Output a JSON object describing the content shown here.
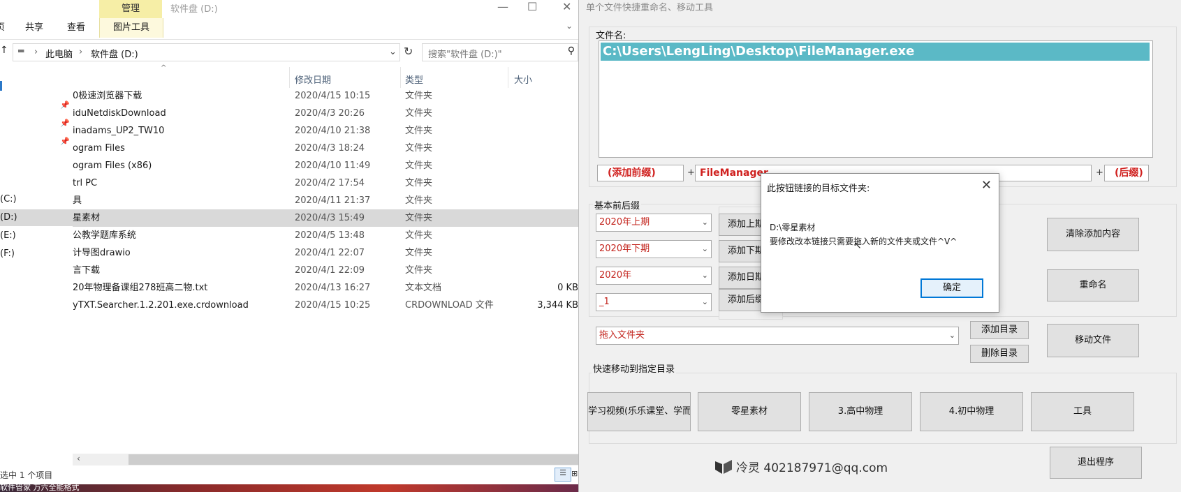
{
  "explorer": {
    "ribbon_tabs": [
      "页",
      "共享",
      "查看"
    ],
    "manage_tab": "管理",
    "picture_tools": "图片工具",
    "window_title": "软件盘 (D:)",
    "breadcrumb": [
      "此电脑",
      "软件盘 (D:)"
    ],
    "search_placeholder": "搜索\"软件盘 (D:)\"",
    "columns": {
      "date": "修改日期",
      "type": "类型",
      "size": "大小"
    },
    "nav_items": [
      "(C:)",
      "(D:)",
      "(E:)",
      "(F:)"
    ],
    "files": [
      {
        "name": "0极速浏览器下载",
        "date": "2020/4/15 10:15",
        "type": "文件夹",
        "size": ""
      },
      {
        "name": "iduNetdiskDownload",
        "date": "2020/4/3 20:26",
        "type": "文件夹",
        "size": ""
      },
      {
        "name": "inadams_UP2_TW10",
        "date": "2020/4/10 21:38",
        "type": "文件夹",
        "size": ""
      },
      {
        "name": "ogram Files",
        "date": "2020/4/3 18:24",
        "type": "文件夹",
        "size": ""
      },
      {
        "name": "ogram Files (x86)",
        "date": "2020/4/10 11:49",
        "type": "文件夹",
        "size": ""
      },
      {
        "name": "trl PC",
        "date": "2020/4/2 17:54",
        "type": "文件夹",
        "size": ""
      },
      {
        "name": "具",
        "date": "2020/4/11 21:37",
        "type": "文件夹",
        "size": ""
      },
      {
        "name": "星素材",
        "date": "2020/4/3 15:49",
        "type": "文件夹",
        "size": ""
      },
      {
        "name": "公教学题库系统",
        "date": "2020/4/5 13:48",
        "type": "文件夹",
        "size": ""
      },
      {
        "name": "计导图drawio",
        "date": "2020/4/1 22:07",
        "type": "文件夹",
        "size": ""
      },
      {
        "name": "言下载",
        "date": "2020/4/1 22:09",
        "type": "文件夹",
        "size": ""
      },
      {
        "name": "20年物理备课组278班高二物.txt",
        "date": "2020/4/13 16:27",
        "type": "文本文档",
        "size": "0 KB"
      },
      {
        "name": "yTXT.Searcher.1.2.201.exe.crdownload",
        "date": "2020/4/15 10:25",
        "type": "CRDOWNLOAD 文件",
        "size": "3,344 KB"
      }
    ],
    "selected_file_index": 7,
    "status": "选中 1 个项目",
    "status_under": "软件管家 万六全能格式"
  },
  "tool": {
    "title": "单个文件快捷重命名、移动工具",
    "file_label": "文件名:",
    "file_path": "C:\\Users\\LengLing\\Desktop\\FileManager.exe",
    "prefix": "(添加前缀)",
    "name_part": "FileManager",
    "suffix": "(后缀)",
    "plus": "+",
    "basic_group": "基本前后缀",
    "combos": [
      "2020年上期",
      "2020年下期",
      "2020年",
      "_1"
    ],
    "add_buttons": [
      "添加上期",
      "添加下期",
      "添加日期",
      "添加后缀"
    ],
    "clear_button": "清除添加内容",
    "rename_button": "重命名",
    "drop_folder": "拖入文件夹",
    "add_dir_button": "添加目录",
    "del_dir_button": "删除目录",
    "move_button": "移动文件",
    "quick_group": "快速移动到指定目录",
    "quick_buttons": [
      "学习视频(乐乐课堂、学而",
      "零星素材",
      "3.高中物理",
      "4.初中物理",
      "工具"
    ],
    "credit": "冷灵 402187971@qq.com",
    "exit_button": "退出程序"
  },
  "dialog": {
    "title": "此按钮链接的目标文件夹:",
    "path": "D:\\零星素材",
    "message": "要修改改本链接只需要拖入新的文件夹或文件^V^",
    "ok": "确定"
  }
}
